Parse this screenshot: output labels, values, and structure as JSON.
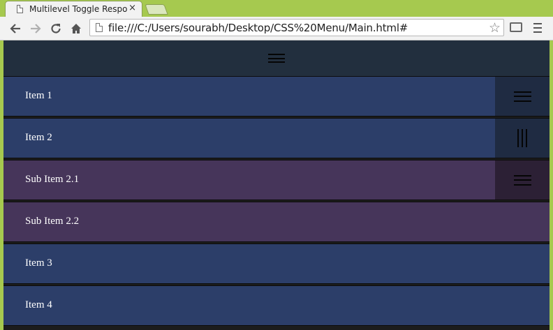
{
  "browser": {
    "tab_title": "Multilevel Toggle Respons",
    "tab_close": "×",
    "url": "file:///C:/Users/sourabh/Desktop/CSS%20Menu/Main.html#"
  },
  "menu": {
    "items": [
      {
        "label": "Item 1",
        "toggle": "hamburger-icon"
      },
      {
        "label": "Item 2",
        "toggle": "vertical-bars-icon"
      },
      {
        "label": "Sub Item 2.1",
        "toggle": "hamburger-icon"
      },
      {
        "label": "Sub Item 2.2"
      },
      {
        "label": "Item 3"
      },
      {
        "label": "Item 4"
      }
    ]
  },
  "colors": {
    "topbar": "#222f3e",
    "item": "#2c3e69",
    "sub_item": "#46355a",
    "browser_frame": "#a6c94f"
  }
}
